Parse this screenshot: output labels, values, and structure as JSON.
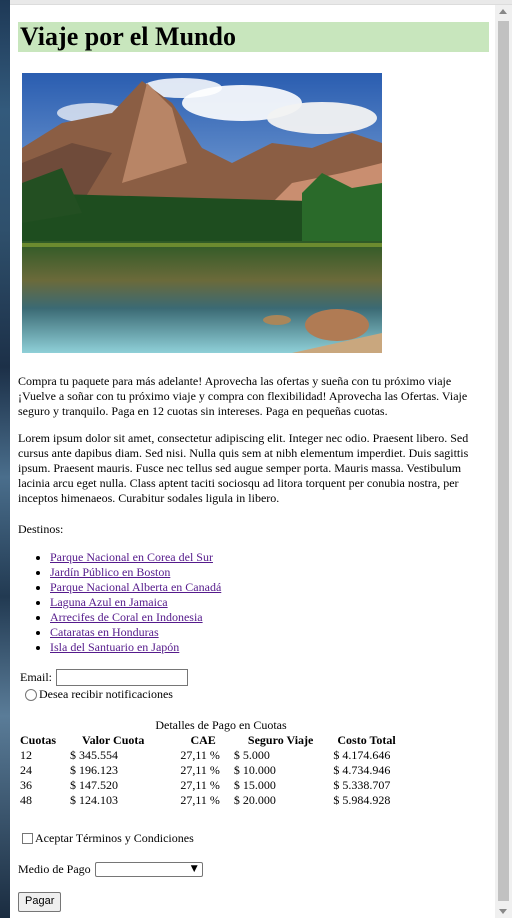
{
  "page": {
    "title": "Viaje por el Mundo",
    "para1": "Compra tu paquete para más adelante! Aprovecha las ofertas y sueña con tu próximo viaje ¡Vuelve a soñar con tu próximo viaje y compra con flexibilidad! Aprovecha las Ofertas. Viaje seguro y tranquilo. Paga en 12 cuotas sin intereses. Paga en pequeñas cuotas.",
    "para2": "Lorem ipsum dolor sit amet, consectetur adipiscing elit. Integer nec odio. Praesent libero. Sed cursus ante dapibus diam. Sed nisi. Nulla quis sem at nibh elementum imperdiet. Duis sagittis ipsum. Praesent mauris. Fusce nec tellus sed augue semper porta. Mauris massa. Vestibulum lacinia arcu eget nulla. Class aptent taciti sociosqu ad litora torquent per conubia nostra, per inceptos himenaeos. Curabitur sodales ligula in libero.",
    "destinos_label": "Destinos:",
    "destinos": [
      "Parque Nacional en Corea del Sur",
      "Jardín Público en Boston",
      "Parque Nacional Alberta en Canadá",
      "Laguna Azul en Jamaica",
      "Arrecifes de Coral en Indonesia",
      "Cataratas en Honduras",
      "Isla del Santuario en Japón"
    ],
    "email_label": "Email:",
    "email_value": "",
    "notif_label": "Desea recibir notificaciones",
    "payment": {
      "caption": "Detalles de Pago en Cuotas",
      "headers": [
        "Cuotas",
        "Valor Cuota",
        "CAE",
        "Seguro Viaje",
        "Costo Total"
      ],
      "rows": [
        [
          "12",
          "$ 345.554",
          "27,11 %",
          "$ 5.000",
          "$ 4.174.646"
        ],
        [
          "24",
          "$ 196.123",
          "27,11 %",
          "$ 10.000",
          "$ 4.734.946"
        ],
        [
          "36",
          "$ 147.520",
          "27,11 %",
          "$ 15.000",
          "$ 5.338.707"
        ],
        [
          "48",
          "$ 124.103",
          "27,11 %",
          "$ 20.000",
          "$ 5.984.928"
        ]
      ]
    },
    "terms_label": "Aceptar Términos y Condiciones",
    "medio_label": "Medio de Pago",
    "medio_selected": "",
    "pay_button": "Pagar"
  },
  "colors": {
    "title_bg": "#c8e6bd",
    "link": "#551a8b",
    "scrollbar_thumb": "#c1c1c1"
  },
  "icons": {
    "select_chevron": "chevron-down-icon"
  }
}
